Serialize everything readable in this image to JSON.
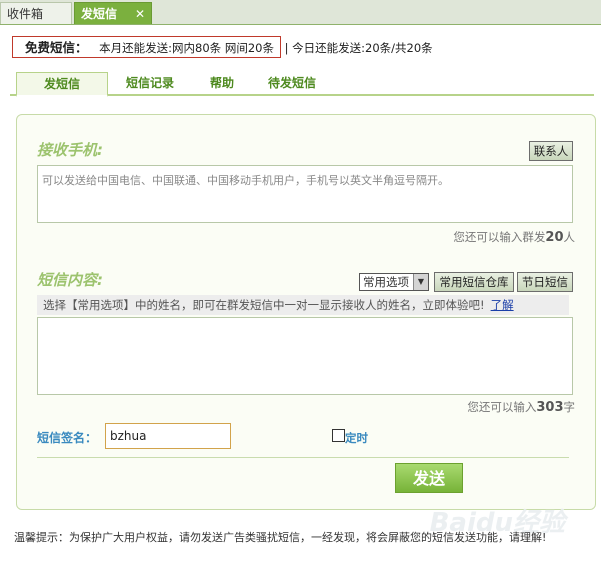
{
  "tabs": {
    "inbox": "收件箱",
    "send_sms": "发短信",
    "close_symbol": "✕"
  },
  "quota": {
    "label": "免费短信：",
    "month_text": "本月还能发送:网内80条 网间20条",
    "separator": "|",
    "today_text": "今日还能发送:20条/共20条"
  },
  "subtabs": [
    "发短信",
    "短信记录",
    "帮助",
    "待发短信"
  ],
  "recipient": {
    "title": "接收手机:",
    "contacts_button": "联系人",
    "placeholder": "可以发送给中国电信、中国联通、中国移动手机用户，手机号以英文半角逗号隔开。",
    "remaining_prefix": "您还可以输入群发",
    "remaining_count": "20",
    "remaining_suffix": "人"
  },
  "content": {
    "title": "短信内容:",
    "select_value": "常用选项",
    "warehouse_button": "常用短信仓库",
    "holiday_button": "节日短信",
    "tip_text": "选择【常用选项】中的姓名，即可在群发短信中一对一显示接收人的姓名，立即体验吧!",
    "tip_link": "了解",
    "remaining_prefix": "您还可以输入",
    "remaining_count": "303",
    "remaining_suffix": "字"
  },
  "signature": {
    "label": "短信签名：",
    "value": "bzhua",
    "timer_label": "定时"
  },
  "send_button": "发送",
  "footer": "温馨提示：为保护广大用户权益，请勿发送广告类骚扰短信，一经发现，将会屏蔽您的短信发送功能，请理解!",
  "watermark": "Baidu经验",
  "colors": {
    "accent_green": "#7bb03e",
    "title_green": "#9cc36e",
    "link_blue": "#1a3ea8",
    "quota_border": "#c0392b"
  }
}
